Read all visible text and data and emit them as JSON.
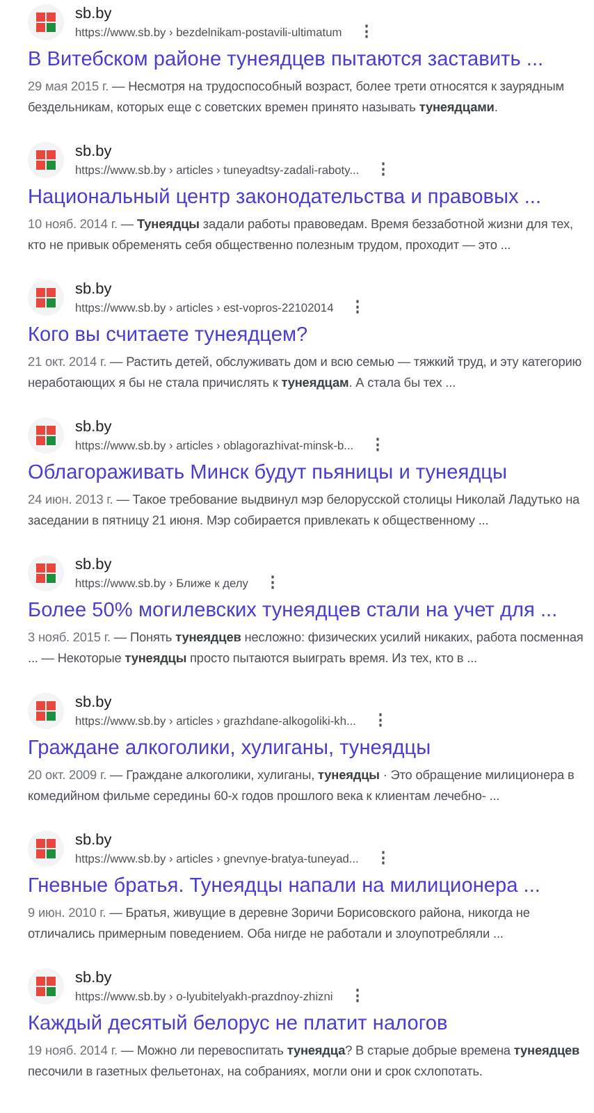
{
  "results": [
    {
      "site": "sb.by",
      "url": "https://www.sb.by › bezdelnikam-postavili-ultimatum",
      "menu": "⋮",
      "title": "В Витебском районе тунеядцев пытаются заставить ...",
      "date": "29 мая 2015 г.",
      "snippet": " — Несмотря на трудоспособный возраст, более трети относятся к заурядным бездельникам, которых еще с советских времен принято называть **тунеядцами**."
    },
    {
      "site": "sb.by",
      "url": "https://www.sb.by › articles › tuneyadtsy-zadali-raboty...",
      "menu": "⋮",
      "title": "Национальный центр законодательства и правовых ...",
      "date": "10 нояб. 2014 г.",
      "snippet": " — **Тунеядцы** задали работы правоведам. Время беззаботной жизни для тех, кто не привык обременять себя общественно полезным трудом, проходит — это ..."
    },
    {
      "site": "sb.by",
      "url": "https://www.sb.by › articles › est-vopros-22102014",
      "menu": "⋮",
      "title": "Кого вы считаете тунеядцем?",
      "date": "21 окт. 2014 г.",
      "snippet": " — Растить детей, обслуживать дом и всю семью — тяжкий труд, и эту категорию неработающих я бы не стала причислять к **тунеядцам**. А стала бы тех ..."
    },
    {
      "site": "sb.by",
      "url": "https://www.sb.by › articles › oblagorazhivat-minsk-b...",
      "menu": "⋮",
      "title": "Облагораживать Минск будут пьяницы и тунеядцы",
      "date": "24 июн. 2013 г.",
      "snippet": " — Такое требование выдвинул мэр белорусской столицы Николай Ладутько на заседании в пятницу 21 июня. Мэр собирается привлекать к общественному ..."
    },
    {
      "site": "sb.by",
      "url": "https://www.sb.by › Ближе к делу",
      "menu": "⋮",
      "title": "Более 50% могилевских тунеядцев стали на учет для ...",
      "date": "3 нояб. 2015 г.",
      "snippet": " — Понять **тунеядцев** несложно: физических усилий никаких, работа посменная ... — Некоторые **тунеядцы** просто пытаются выиграть время. Из тех, кто в ..."
    },
    {
      "site": "sb.by",
      "url": "https://www.sb.by › articles › grazhdane-alkogoliki-kh...",
      "menu": "⋮",
      "title": "Граждане алкоголики, хулиганы, тунеядцы",
      "date": "20 окт. 2009 г.",
      "snippet": " — Граждане алкоголики, хулиганы, **тунеядцы** · Это обращение милиционера в комедийном фильме середины 60-х годов прошлого века к клиентам лечебно- ..."
    },
    {
      "site": "sb.by",
      "url": "https://www.sb.by › articles › gnevnye-bratya-tuneyad...",
      "menu": "⋮",
      "title": "Гневные братья. Тунеядцы напали на милиционера ...",
      "date": "9 июн. 2010 г.",
      "snippet": " — Братья, живущие в деревне Зоричи Борисовского района, никогда не отличались примерным поведением. Оба нигде не работали и злоупотребляли ..."
    },
    {
      "site": "sb.by",
      "url": "https://www.sb.by › o-lyubitelyakh-prazdnoy-zhizni",
      "menu": "⋮",
      "title": "Каждый десятый белорус не платит налогов",
      "date": "19 нояб. 2014 г.",
      "snippet": " — Можно ли перевоспитать **тунеядца**? В старые добрые времена **тунеядцев** песочили в газетных фельетонах, на собраниях, могли они и срок схлопотать."
    }
  ]
}
